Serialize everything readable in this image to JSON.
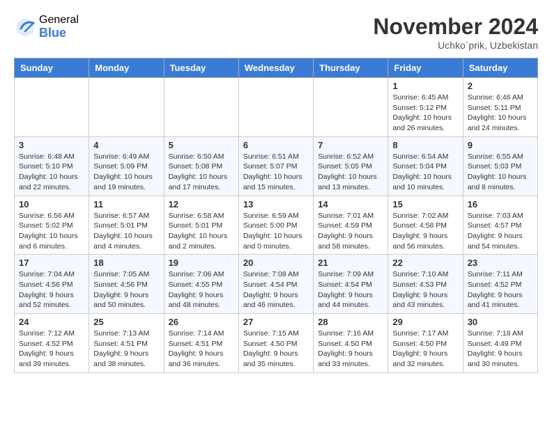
{
  "logo": {
    "general": "General",
    "blue": "Blue"
  },
  "title": "November 2024",
  "location": "Uchko`prik, Uzbekistan",
  "weekdays": [
    "Sunday",
    "Monday",
    "Tuesday",
    "Wednesday",
    "Thursday",
    "Friday",
    "Saturday"
  ],
  "weeks": [
    [
      {
        "day": "",
        "info": ""
      },
      {
        "day": "",
        "info": ""
      },
      {
        "day": "",
        "info": ""
      },
      {
        "day": "",
        "info": ""
      },
      {
        "day": "",
        "info": ""
      },
      {
        "day": "1",
        "info": "Sunrise: 6:45 AM\nSunset: 5:12 PM\nDaylight: 10 hours and 26 minutes."
      },
      {
        "day": "2",
        "info": "Sunrise: 6:46 AM\nSunset: 5:11 PM\nDaylight: 10 hours and 24 minutes."
      }
    ],
    [
      {
        "day": "3",
        "info": "Sunrise: 6:48 AM\nSunset: 5:10 PM\nDaylight: 10 hours and 22 minutes."
      },
      {
        "day": "4",
        "info": "Sunrise: 6:49 AM\nSunset: 5:09 PM\nDaylight: 10 hours and 19 minutes."
      },
      {
        "day": "5",
        "info": "Sunrise: 6:50 AM\nSunset: 5:08 PM\nDaylight: 10 hours and 17 minutes."
      },
      {
        "day": "6",
        "info": "Sunrise: 6:51 AM\nSunset: 5:07 PM\nDaylight: 10 hours and 15 minutes."
      },
      {
        "day": "7",
        "info": "Sunrise: 6:52 AM\nSunset: 5:05 PM\nDaylight: 10 hours and 13 minutes."
      },
      {
        "day": "8",
        "info": "Sunrise: 6:54 AM\nSunset: 5:04 PM\nDaylight: 10 hours and 10 minutes."
      },
      {
        "day": "9",
        "info": "Sunrise: 6:55 AM\nSunset: 5:03 PM\nDaylight: 10 hours and 8 minutes."
      }
    ],
    [
      {
        "day": "10",
        "info": "Sunrise: 6:56 AM\nSunset: 5:02 PM\nDaylight: 10 hours and 6 minutes."
      },
      {
        "day": "11",
        "info": "Sunrise: 6:57 AM\nSunset: 5:01 PM\nDaylight: 10 hours and 4 minutes."
      },
      {
        "day": "12",
        "info": "Sunrise: 6:58 AM\nSunset: 5:01 PM\nDaylight: 10 hours and 2 minutes."
      },
      {
        "day": "13",
        "info": "Sunrise: 6:59 AM\nSunset: 5:00 PM\nDaylight: 10 hours and 0 minutes."
      },
      {
        "day": "14",
        "info": "Sunrise: 7:01 AM\nSunset: 4:59 PM\nDaylight: 9 hours and 58 minutes."
      },
      {
        "day": "15",
        "info": "Sunrise: 7:02 AM\nSunset: 4:58 PM\nDaylight: 9 hours and 56 minutes."
      },
      {
        "day": "16",
        "info": "Sunrise: 7:03 AM\nSunset: 4:57 PM\nDaylight: 9 hours and 54 minutes."
      }
    ],
    [
      {
        "day": "17",
        "info": "Sunrise: 7:04 AM\nSunset: 4:56 PM\nDaylight: 9 hours and 52 minutes."
      },
      {
        "day": "18",
        "info": "Sunrise: 7:05 AM\nSunset: 4:56 PM\nDaylight: 9 hours and 50 minutes."
      },
      {
        "day": "19",
        "info": "Sunrise: 7:06 AM\nSunset: 4:55 PM\nDaylight: 9 hours and 48 minutes."
      },
      {
        "day": "20",
        "info": "Sunrise: 7:08 AM\nSunset: 4:54 PM\nDaylight: 9 hours and 46 minutes."
      },
      {
        "day": "21",
        "info": "Sunrise: 7:09 AM\nSunset: 4:54 PM\nDaylight: 9 hours and 44 minutes."
      },
      {
        "day": "22",
        "info": "Sunrise: 7:10 AM\nSunset: 4:53 PM\nDaylight: 9 hours and 43 minutes."
      },
      {
        "day": "23",
        "info": "Sunrise: 7:11 AM\nSunset: 4:52 PM\nDaylight: 9 hours and 41 minutes."
      }
    ],
    [
      {
        "day": "24",
        "info": "Sunrise: 7:12 AM\nSunset: 4:52 PM\nDaylight: 9 hours and 39 minutes."
      },
      {
        "day": "25",
        "info": "Sunrise: 7:13 AM\nSunset: 4:51 PM\nDaylight: 9 hours and 38 minutes."
      },
      {
        "day": "26",
        "info": "Sunrise: 7:14 AM\nSunset: 4:51 PM\nDaylight: 9 hours and 36 minutes."
      },
      {
        "day": "27",
        "info": "Sunrise: 7:15 AM\nSunset: 4:50 PM\nDaylight: 9 hours and 35 minutes."
      },
      {
        "day": "28",
        "info": "Sunrise: 7:16 AM\nSunset: 4:50 PM\nDaylight: 9 hours and 33 minutes."
      },
      {
        "day": "29",
        "info": "Sunrise: 7:17 AM\nSunset: 4:50 PM\nDaylight: 9 hours and 32 minutes."
      },
      {
        "day": "30",
        "info": "Sunrise: 7:18 AM\nSunset: 4:49 PM\nDaylight: 9 hours and 30 minutes."
      }
    ]
  ]
}
